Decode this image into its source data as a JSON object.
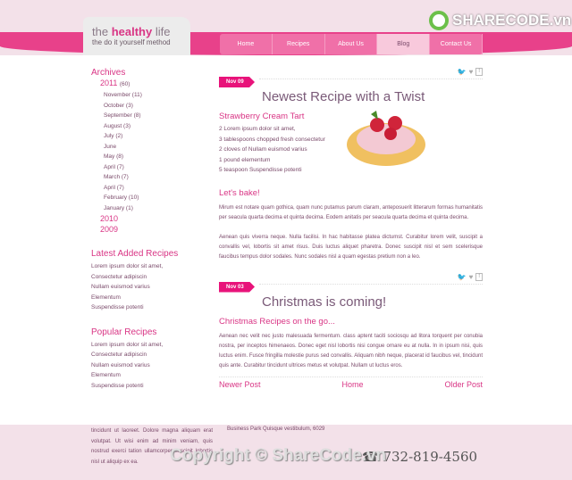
{
  "header": {
    "logo_line1_pre": "the ",
    "logo_line1_bold": "healthy",
    "logo_line1_post": " life",
    "logo_tagline": "the do it yourself method",
    "nav": [
      {
        "label": "Home"
      },
      {
        "label": "Recipes"
      },
      {
        "label": "About Us"
      },
      {
        "label": "Blog",
        "active": true
      },
      {
        "label": "Contact Us"
      }
    ],
    "watermark_logo": "SHARECODE.vn"
  },
  "sidebar": {
    "archives_title": "Archives",
    "years": [
      {
        "year": "2011",
        "count": "(60)",
        "months": [
          "November (11)",
          "October (3)",
          "September (8)",
          "August (3)",
          "July (2)",
          "June",
          "May (8)",
          "April (7)",
          "March (7)",
          "April (7)",
          "February (10)",
          "January (1)"
        ]
      },
      {
        "year": "2010"
      },
      {
        "year": "2009"
      }
    ],
    "latest_title": "Latest Added Recipes",
    "latest": [
      "Lorem ipsum dolor sit amet,",
      "Consectetur adipiscin",
      "Nullam euismod varius",
      "Elementum",
      "Suspendisse potenti"
    ],
    "popular_title": "Popular Recipes",
    "popular": [
      "Lorem ipsum dolor sit amet,",
      "Consectetur adipiscin",
      "Nullam euismod varius",
      "Elementum",
      "Suspendisse potenti"
    ]
  },
  "posts": [
    {
      "date": "Nov 09",
      "title": "Newest Recipe with a Twist",
      "subtitle": "Strawberry Cream Tart",
      "ingredients": [
        "2 Lorem ipsum dolor sit amet,",
        "3 tablespoons chopped fresh consectetur",
        "2 cloves of Nullam euismod varius",
        "1 pound elementum",
        "5 teaspoon Suspendisse potenti"
      ],
      "section": "Let's bake!",
      "paragraphs": [
        "Mirum est notare quam gothica, quam nunc putamus parum claram, anteposuerit litterarum formas humanitatis per seacula quarta decima et quinta decima. Eodem anitatis per seacula quarta decima et quinta decima.",
        "Aenean quis viverra neque. Nulla facilisi. In hac habitasse platea dictumst. Curabitur lorem velit, suscipit a convallis vel, lobortis sit amet risus. Duis luctus aliquet pharetra. Donec suscipit nisl et sem scelerisque faucibus tempus dolor sodales. Nunc sodales nisl a quam egestas pretium non a leo."
      ]
    },
    {
      "date": "Nov 03",
      "title": "Christmas is coming!",
      "subtitle": "Christmas Recipes on the go...",
      "paragraphs": [
        "Aenean nec velit nec justo malesuada fermentum. class aptent taciti sociosqu ad litora torquent per conubia nostra, per inceptos himenaeos. Donec eget nisl lobortis nisi congue ornare eu at nulla. In in ipsum nisi, quis luctus enim. Fusce fringilla molestie purus sed convallis. Aliquam nibh neque, placerat id faucibus vel, tincidunt quis ante. Curabitur tincidunt ultrices metus et volutpat. Nullam ut luctus eros."
      ]
    }
  ],
  "pager": {
    "newer": "Newer Post",
    "home": "Home",
    "older": "Older Post"
  },
  "footer": {
    "text": "tincidunt ut laoreet. Dolore magna aliquam erat volutpat. Ut wisi enim ad minim veniam, quis nostrud exerci tation ullamcorper suscipit lobortis nisl ut aliquip ex ea.",
    "address": "Business Park Quisque vestibulum, 6029",
    "phone": "732-819-4560",
    "copyright_watermark": "Copyright © ShareCode.vn"
  }
}
